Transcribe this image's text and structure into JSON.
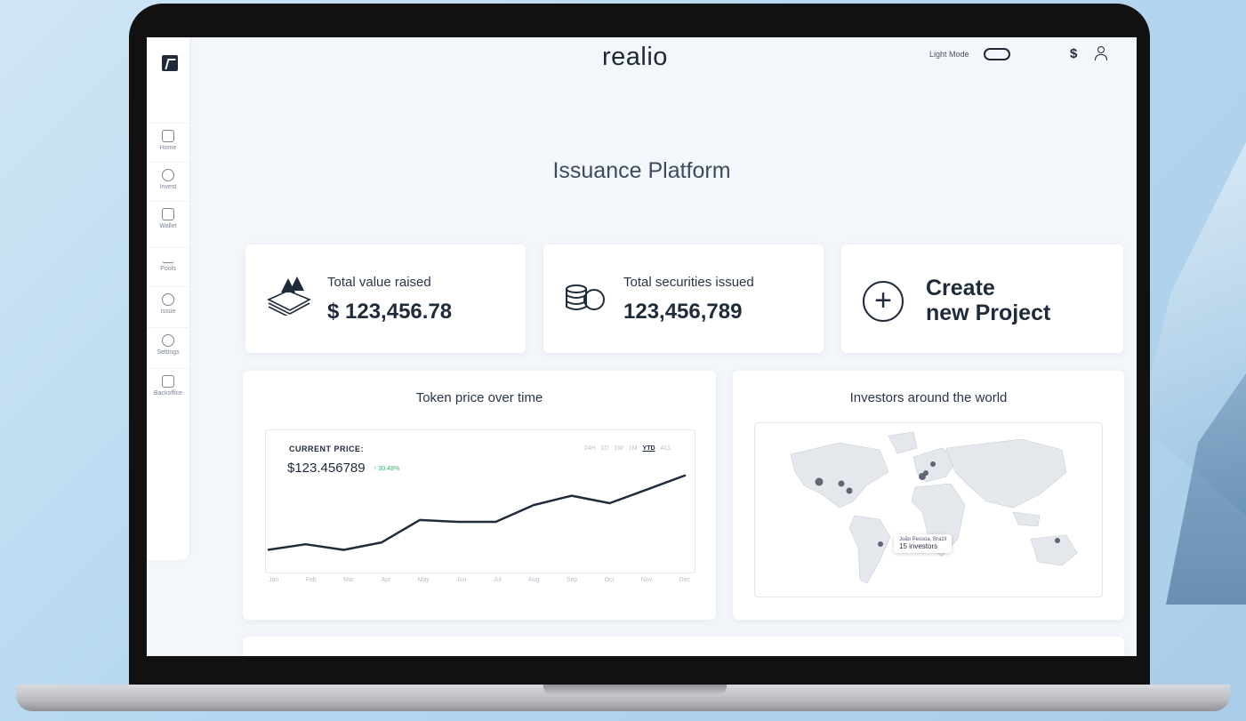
{
  "header": {
    "brand": "realio",
    "mode_label": "Light Mode",
    "currency_symbol": "$"
  },
  "sidebar": {
    "items": [
      {
        "label": "Home",
        "icon": "home-icon"
      },
      {
        "label": "Invest",
        "icon": "invest-icon"
      },
      {
        "label": "Wallet",
        "icon": "wallet-icon"
      },
      {
        "label": "Pools",
        "icon": "pools-icon"
      },
      {
        "label": "Issue",
        "icon": "issue-icon"
      },
      {
        "label": "Settings",
        "icon": "settings-icon"
      },
      {
        "label": "Backoffice",
        "icon": "backoffice-icon"
      }
    ]
  },
  "page": {
    "title": "Issuance Platform"
  },
  "stats": {
    "value_raised": {
      "label": "Total value raised",
      "value": "$ 123,456.78"
    },
    "securities_issued": {
      "label": "Total securities issued",
      "value": "123,456,789"
    }
  },
  "create_project": {
    "line1": "Create",
    "line2": "new Project"
  },
  "token_chart": {
    "title": "Token price over time",
    "current_price_label": "CURRENT PRICE:",
    "current_price": "$123.456789",
    "change": "↑ 30.48%",
    "ranges": [
      "24H",
      "1D",
      "1W",
      "1M",
      "YTD",
      "ALL"
    ],
    "active_range": "YTD"
  },
  "chart_data": {
    "type": "line",
    "title": "Token price over time",
    "categories": [
      "Jan",
      "Feb",
      "Mar",
      "Apr",
      "May",
      "Jun",
      "Jul",
      "Aug",
      "Sep",
      "Oct",
      "Nov",
      "Dec"
    ],
    "series": [
      {
        "values": [
          10,
          16,
          10,
          18,
          42,
          40,
          40,
          58,
          68,
          60,
          75,
          90
        ]
      }
    ],
    "ylim": [
      0,
      100
    ],
    "grid": false
  },
  "investors_map": {
    "title": "Investors around the world",
    "tooltip_location": "João Pessoa, Brazil",
    "tooltip_count": "15 investors"
  },
  "colors": {
    "accent": "#2bb673",
    "ink": "#1f2b3a",
    "marker": "#5e6875"
  }
}
